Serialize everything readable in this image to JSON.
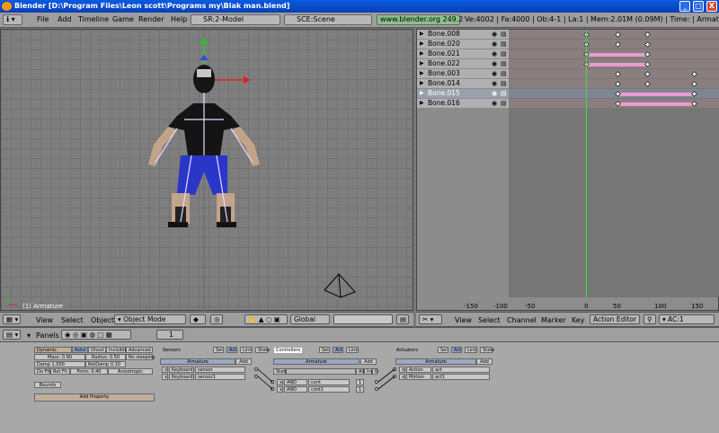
{
  "titlebar": {
    "title": "Blender [D:\\Program Files\\Leon scott\\Programs my\\Blak man.blend]",
    "min": "_",
    "max": "□",
    "close": "X"
  },
  "menu": {
    "items": [
      "File",
      "Add",
      "Timeline",
      "Game",
      "Render",
      "Help"
    ],
    "screen": "SR:2-Model",
    "scene": "SCE:Scene",
    "site": "www.blender.org 249.2",
    "stats": "Ve:4002 | Fa:4000 | Ob:4-1 | La:1  | Mem:2.01M (0.09M)  | Time: | Armature"
  },
  "viewport": {
    "label": "(1) Armature",
    "header": {
      "view": "View",
      "select": "Select",
      "object": "Object",
      "mode": "Object Mode",
      "orientation": "Global"
    }
  },
  "action": {
    "channels": [
      {
        "name": "Bone.008"
      },
      {
        "name": "Bone.020"
      },
      {
        "name": "Bone.021"
      },
      {
        "name": "Bone.022"
      },
      {
        "name": "Bone.003"
      },
      {
        "name": "Bone.014"
      },
      {
        "name": "Bone.015",
        "selected": true
      },
      {
        "name": "Bone.016"
      }
    ],
    "ticks": [
      "-150",
      "-100",
      "-50",
      "0",
      "50",
      "100",
      "150"
    ],
    "header": {
      "view": "View",
      "select": "Select",
      "channel": "Channel",
      "marker": "Marker",
      "key": "Key",
      "editor": "Action Editor",
      "ac": "AC:1"
    }
  },
  "buttons": {
    "header": {
      "panels": "Panels",
      "frame": "1"
    },
    "physics": {
      "dynamic": "Dynamic",
      "actor": "Actor",
      "ghost": "Ghost",
      "invisible": "Invisible",
      "advanced": "Advanced",
      "mass": "Mass: 0.90",
      "radius": "Radius: 0.50",
      "nosleeping": "No sleeping",
      "damp": "Damp 1.000",
      "rotdamp": "RotDamp 0.10",
      "dofh": "Do Fh",
      "rotfh": "Rot Fh",
      "form": "Form: 0.40",
      "aniso": "Anisotropic",
      "bounds": "Bounds",
      "addprop": "Add Property"
    },
    "sensors": {
      "title": "Sensors",
      "sel": "Sel",
      "act": "Act",
      "link": "Link",
      "state": "State",
      "obj": "Armature",
      "add": "Add",
      "rows": [
        {
          "type": "Keyboard",
          "name": "sensor"
        },
        {
          "type": "Keyboard",
          "name": "sensor1"
        }
      ]
    },
    "controllers": {
      "title": "Controllers",
      "sel": "Sel",
      "act": "Act",
      "link": "Link",
      "obj": "Armature",
      "add": "Add",
      "state": "State",
      "all": "All",
      "ini": "Ini",
      "d": "D",
      "rows": [
        {
          "type": "AND",
          "name": "cont",
          "num": "1"
        },
        {
          "type": "AND",
          "name": "cont1",
          "num": "1"
        }
      ]
    },
    "actuators": {
      "title": "Actuators",
      "sel": "Sel",
      "act": "Act",
      "link": "Link",
      "state": "State",
      "obj": "Armature",
      "add": "Add",
      "rows": [
        {
          "type": "Action",
          "name": "act"
        },
        {
          "type": "Motion",
          "name": "act1"
        }
      ]
    }
  },
  "colors": {
    "accent": "#0a5be0",
    "key_bar": "#e89ccf",
    "current_frame": "#40e040"
  }
}
